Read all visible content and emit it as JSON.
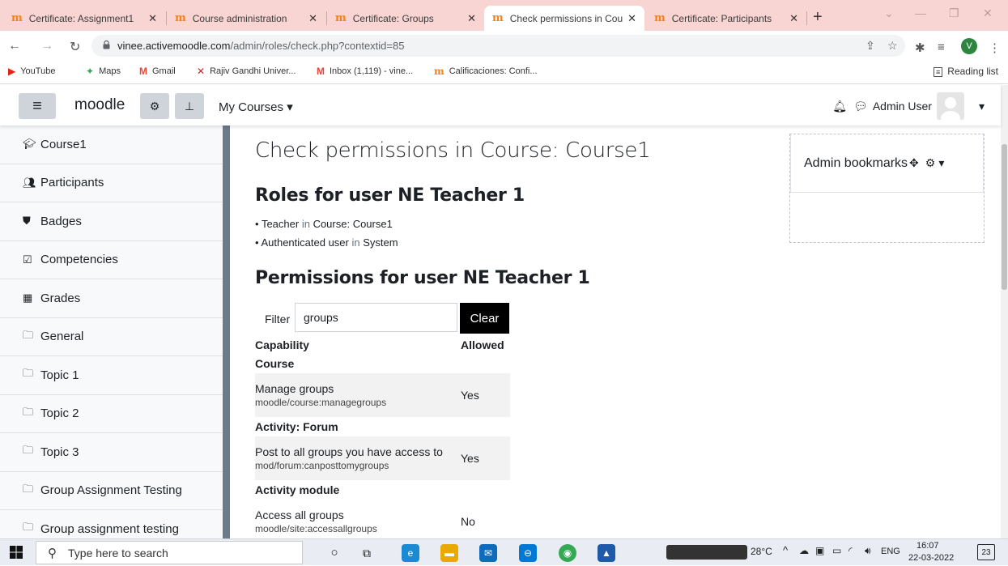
{
  "browser": {
    "tabs": [
      {
        "title": "Certificate: Assignment1",
        "active": false
      },
      {
        "title": "Course administration",
        "active": false
      },
      {
        "title": "Certificate: Groups",
        "active": false
      },
      {
        "title": "Check permissions in Cou",
        "active": true
      },
      {
        "title": "Certificate: Participants",
        "active": false
      }
    ],
    "url_host": "vinee.activemoodle.com",
    "url_path": "/admin/roles/check.php?contextid=85",
    "profile_initial": "V",
    "bookmarks": [
      "YouTube",
      "Maps",
      "Gmail",
      "Rajiv Gandhi Univer...",
      "Inbox (1,119) - vine...",
      "Calificaciones: Confi..."
    ],
    "reading_list": "Reading list"
  },
  "navbar": {
    "brand": "moodle",
    "my_courses": "My Courses",
    "user_name": "Admin User"
  },
  "drawer": {
    "items": [
      {
        "label": "Course1",
        "icon": "graduation-cap-icon"
      },
      {
        "label": "Participants",
        "icon": "users-icon"
      },
      {
        "label": "Badges",
        "icon": "shield-icon"
      },
      {
        "label": "Competencies",
        "icon": "check-square-icon"
      },
      {
        "label": "Grades",
        "icon": "table-icon"
      },
      {
        "label": "General",
        "icon": "folder-icon"
      },
      {
        "label": "Topic 1",
        "icon": "folder-icon"
      },
      {
        "label": "Topic 2",
        "icon": "folder-icon"
      },
      {
        "label": "Topic 3",
        "icon": "folder-icon"
      },
      {
        "label": "Group Assignment Testing",
        "icon": "folder-icon"
      },
      {
        "label": "Group assignment testing",
        "icon": "folder-icon"
      }
    ]
  },
  "main": {
    "title": "Check permissions in Course: Course1",
    "roles_heading": "Roles for user NE Teacher 1",
    "roles": [
      {
        "role": "Teacher",
        "in": "in",
        "context": "Course: Course1"
      },
      {
        "role": "Authenticated user",
        "in": "in",
        "context": "System"
      }
    ],
    "permissions_heading": "Permissions for user NE Teacher 1",
    "filter_label": "Filter",
    "filter_value": "groups",
    "clear_label": "Clear",
    "table": {
      "col_capability": "Capability",
      "col_allowed": "Allowed",
      "groups": [
        {
          "name": "Course",
          "rows": [
            {
              "name": "Manage groups",
              "id": "moodle/course:managegroups",
              "allowed": "Yes"
            }
          ]
        },
        {
          "name": "Activity: Forum",
          "rows": [
            {
              "name": "Post to all groups you have access to",
              "id": "mod/forum:canposttomygroups",
              "allowed": "Yes"
            }
          ]
        },
        {
          "name": "Activity module",
          "rows": [
            {
              "name": "Access all groups",
              "id": "moodle/site:accessallgroups",
              "allowed": "No"
            }
          ]
        }
      ]
    }
  },
  "block": {
    "title": "Admin bookmarks"
  },
  "taskbar": {
    "search_placeholder": "Type here to search",
    "temp": "28°C",
    "lang": "ENG",
    "time": "16:07",
    "date": "22-03-2022",
    "notif_count": "23"
  }
}
